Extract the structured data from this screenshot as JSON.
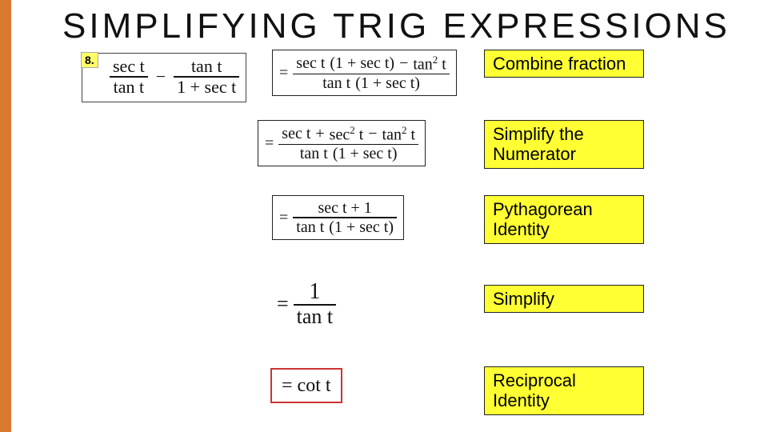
{
  "accent_height": "540",
  "title": "SIMPLIFYING TRIG EXPRESSIONS",
  "qnum": "8.",
  "problem": {
    "f1n": "sec t",
    "f1d": "tan t",
    "minus": "−",
    "f2n": "tan t",
    "f2d": "1 + sec t"
  },
  "step1": {
    "eq": "=",
    "num_a": "sec t",
    "num_paren": "(1 + sec t)",
    "num_minus": "−",
    "num_b_base": "tan",
    "num_b_exp": "2",
    "num_b_t": "t",
    "den_a": "tan t",
    "den_paren": "(1 + sec t)"
  },
  "step2": {
    "eq": "=",
    "num_a": "sec t",
    "num_plus1": "+",
    "num_b_base": "sec",
    "num_b_exp": "2",
    "num_b_t": "t",
    "num_minus": "−",
    "num_c_base": "tan",
    "num_c_exp": "2",
    "num_c_t": "t",
    "den_a": "tan t",
    "den_paren": "(1 + sec t)"
  },
  "step3": {
    "eq": "=",
    "num": "sec t + 1",
    "den_a": "tan t",
    "den_paren": "(1 + sec t)"
  },
  "step4": {
    "eq": "=",
    "num": "1",
    "den": "tan t"
  },
  "final": {
    "eq": "=",
    "expr": "cot t"
  },
  "labels": {
    "l1": "Combine fraction",
    "l2": "Simplify the Numerator",
    "l3": "Pythagorean Identity",
    "l4": "Simplify",
    "l5": "Reciprocal Identity"
  }
}
